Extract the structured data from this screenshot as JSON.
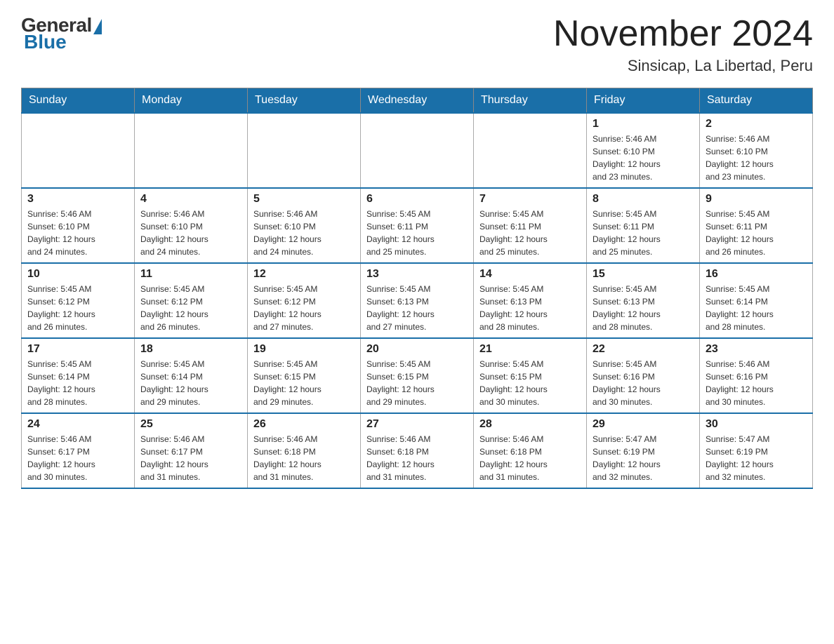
{
  "header": {
    "logo_general": "General",
    "logo_blue": "Blue",
    "title": "November 2024",
    "subtitle": "Sinsicap, La Libertad, Peru"
  },
  "weekdays": [
    "Sunday",
    "Monday",
    "Tuesday",
    "Wednesday",
    "Thursday",
    "Friday",
    "Saturday"
  ],
  "weeks": [
    [
      {
        "day": "",
        "info": ""
      },
      {
        "day": "",
        "info": ""
      },
      {
        "day": "",
        "info": ""
      },
      {
        "day": "",
        "info": ""
      },
      {
        "day": "",
        "info": ""
      },
      {
        "day": "1",
        "info": "Sunrise: 5:46 AM\nSunset: 6:10 PM\nDaylight: 12 hours\nand 23 minutes."
      },
      {
        "day": "2",
        "info": "Sunrise: 5:46 AM\nSunset: 6:10 PM\nDaylight: 12 hours\nand 23 minutes."
      }
    ],
    [
      {
        "day": "3",
        "info": "Sunrise: 5:46 AM\nSunset: 6:10 PM\nDaylight: 12 hours\nand 24 minutes."
      },
      {
        "day": "4",
        "info": "Sunrise: 5:46 AM\nSunset: 6:10 PM\nDaylight: 12 hours\nand 24 minutes."
      },
      {
        "day": "5",
        "info": "Sunrise: 5:46 AM\nSunset: 6:10 PM\nDaylight: 12 hours\nand 24 minutes."
      },
      {
        "day": "6",
        "info": "Sunrise: 5:45 AM\nSunset: 6:11 PM\nDaylight: 12 hours\nand 25 minutes."
      },
      {
        "day": "7",
        "info": "Sunrise: 5:45 AM\nSunset: 6:11 PM\nDaylight: 12 hours\nand 25 minutes."
      },
      {
        "day": "8",
        "info": "Sunrise: 5:45 AM\nSunset: 6:11 PM\nDaylight: 12 hours\nand 25 minutes."
      },
      {
        "day": "9",
        "info": "Sunrise: 5:45 AM\nSunset: 6:11 PM\nDaylight: 12 hours\nand 26 minutes."
      }
    ],
    [
      {
        "day": "10",
        "info": "Sunrise: 5:45 AM\nSunset: 6:12 PM\nDaylight: 12 hours\nand 26 minutes."
      },
      {
        "day": "11",
        "info": "Sunrise: 5:45 AM\nSunset: 6:12 PM\nDaylight: 12 hours\nand 26 minutes."
      },
      {
        "day": "12",
        "info": "Sunrise: 5:45 AM\nSunset: 6:12 PM\nDaylight: 12 hours\nand 27 minutes."
      },
      {
        "day": "13",
        "info": "Sunrise: 5:45 AM\nSunset: 6:13 PM\nDaylight: 12 hours\nand 27 minutes."
      },
      {
        "day": "14",
        "info": "Sunrise: 5:45 AM\nSunset: 6:13 PM\nDaylight: 12 hours\nand 28 minutes."
      },
      {
        "day": "15",
        "info": "Sunrise: 5:45 AM\nSunset: 6:13 PM\nDaylight: 12 hours\nand 28 minutes."
      },
      {
        "day": "16",
        "info": "Sunrise: 5:45 AM\nSunset: 6:14 PM\nDaylight: 12 hours\nand 28 minutes."
      }
    ],
    [
      {
        "day": "17",
        "info": "Sunrise: 5:45 AM\nSunset: 6:14 PM\nDaylight: 12 hours\nand 28 minutes."
      },
      {
        "day": "18",
        "info": "Sunrise: 5:45 AM\nSunset: 6:14 PM\nDaylight: 12 hours\nand 29 minutes."
      },
      {
        "day": "19",
        "info": "Sunrise: 5:45 AM\nSunset: 6:15 PM\nDaylight: 12 hours\nand 29 minutes."
      },
      {
        "day": "20",
        "info": "Sunrise: 5:45 AM\nSunset: 6:15 PM\nDaylight: 12 hours\nand 29 minutes."
      },
      {
        "day": "21",
        "info": "Sunrise: 5:45 AM\nSunset: 6:15 PM\nDaylight: 12 hours\nand 30 minutes."
      },
      {
        "day": "22",
        "info": "Sunrise: 5:45 AM\nSunset: 6:16 PM\nDaylight: 12 hours\nand 30 minutes."
      },
      {
        "day": "23",
        "info": "Sunrise: 5:46 AM\nSunset: 6:16 PM\nDaylight: 12 hours\nand 30 minutes."
      }
    ],
    [
      {
        "day": "24",
        "info": "Sunrise: 5:46 AM\nSunset: 6:17 PM\nDaylight: 12 hours\nand 30 minutes."
      },
      {
        "day": "25",
        "info": "Sunrise: 5:46 AM\nSunset: 6:17 PM\nDaylight: 12 hours\nand 31 minutes."
      },
      {
        "day": "26",
        "info": "Sunrise: 5:46 AM\nSunset: 6:18 PM\nDaylight: 12 hours\nand 31 minutes."
      },
      {
        "day": "27",
        "info": "Sunrise: 5:46 AM\nSunset: 6:18 PM\nDaylight: 12 hours\nand 31 minutes."
      },
      {
        "day": "28",
        "info": "Sunrise: 5:46 AM\nSunset: 6:18 PM\nDaylight: 12 hours\nand 31 minutes."
      },
      {
        "day": "29",
        "info": "Sunrise: 5:47 AM\nSunset: 6:19 PM\nDaylight: 12 hours\nand 32 minutes."
      },
      {
        "day": "30",
        "info": "Sunrise: 5:47 AM\nSunset: 6:19 PM\nDaylight: 12 hours\nand 32 minutes."
      }
    ]
  ]
}
